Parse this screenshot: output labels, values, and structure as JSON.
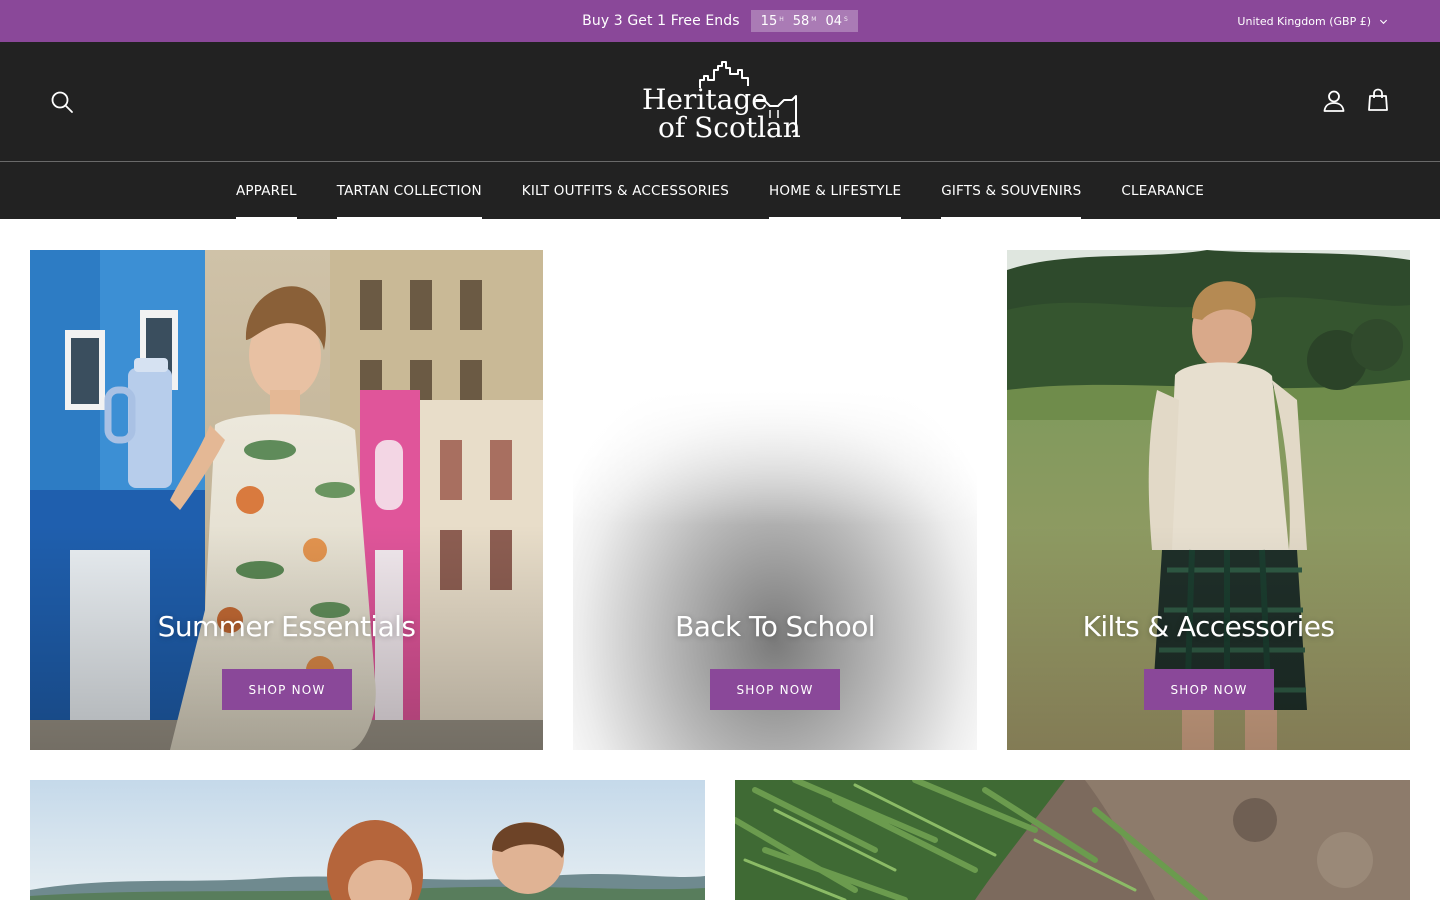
{
  "announcement": {
    "promo_text": "Buy 3 Get 1 Free Ends",
    "countdown": {
      "hours": "15",
      "hours_label": "H",
      "minutes": "58",
      "minutes_label": "M",
      "seconds": "04",
      "seconds_label": "S"
    },
    "locale": "United Kingdom (GBP £)"
  },
  "header": {
    "logo_line1": "Heritage",
    "logo_line2": "of Scotland",
    "icons": [
      "search-icon",
      "account-icon",
      "cart-icon"
    ]
  },
  "nav": {
    "items": [
      {
        "label": "APPAREL"
      },
      {
        "label": "TARTAN COLLECTION"
      },
      {
        "label": "KILT OUTFITS & ACCESSORIES"
      },
      {
        "label": "HOME & LIFESTYLE"
      },
      {
        "label": "GIFTS & SOUVENIRS"
      },
      {
        "label": "CLEARANCE"
      }
    ]
  },
  "categories": [
    {
      "title": "Summer Essentials",
      "button": "SHOP NOW"
    },
    {
      "title": "Back To School",
      "button": "SHOP NOW"
    },
    {
      "title": "Kilts & Accessories",
      "button": "SHOP NOW"
    }
  ],
  "colors": {
    "brand_purple": "#8a4899",
    "header_bg": "#222222",
    "page_bg": "#ffffff"
  }
}
